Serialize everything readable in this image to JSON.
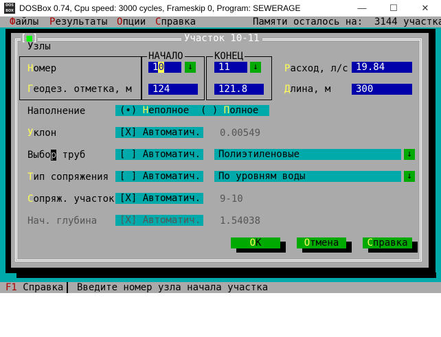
{
  "window": {
    "app_icon_text": "DOS BOX",
    "title": "DOSBox 0.74, Cpu speed:     3000 cycles, Frameskip  0, Program: SEWERAGE",
    "minimize": "—",
    "maximize": "☐",
    "close": "✕"
  },
  "menu": {
    "items": [
      {
        "hot": "Ф",
        "rest": "айлы"
      },
      {
        "hot": "Р",
        "rest": "езультаты"
      },
      {
        "hot": "О",
        "rest": "пции"
      },
      {
        "hot": "С",
        "rest": "правка"
      }
    ],
    "memory_text": "Памяти осталось на:  3144 участка"
  },
  "dialog": {
    "close_left": "[",
    "close_mark": "■",
    "close_right": "]",
    "title": "Участок 10-11",
    "nodes_label": "Узлы",
    "start_label": "НАЧАЛО",
    "end_label": "КОНЕЦ",
    "number": {
      "hot": "Н",
      "rest": "омер"
    },
    "elevation": {
      "hot": "Г",
      "rest": "еодез. отметка, м"
    },
    "start_number": {
      "a": "1",
      "b": "0"
    },
    "end_number": "11",
    "start_elevation": "124",
    "end_elevation": "121.8",
    "flow": {
      "hot": "Р",
      "rest": "асход, л/с"
    },
    "flow_value": "19.84",
    "length": {
      "hot": "Д",
      "rest": "лина, м"
    },
    "length_value": "300",
    "fill_label": "Наполнение",
    "fill_options": {
      "o1_mark": "(•)",
      "o1_hot": "Н",
      "o1_rest": "еполное",
      "o2_mark": "( )",
      "o2_hot": "П",
      "o2_rest": "олное"
    },
    "slope": {
      "hot": "У",
      "rest": "клон"
    },
    "slope_check": "[X] Автоматич.",
    "slope_value": "0.00549",
    "pipe": {
      "pre": "Выбо",
      "cursor": "р",
      "rest": " труб",
      "hot_index": "1"
    },
    "pipe_check": "[ ] Автоматич.",
    "pipe_value": "Полиэтиленовые",
    "conj": {
      "hot": "Т",
      "rest": "ип сопряжения"
    },
    "conj_check": "[ ] Автоматич.",
    "conj_value": "По уровням воды",
    "conj_section": {
      "hot": "С",
      "rest": "опряж. участок"
    },
    "conj_section_check": "[X] Автоматич.",
    "conj_section_value": "9-10",
    "depth_label": "Нач. глубина",
    "depth_check": "[X] Автоматич.",
    "depth_value": "1.54038",
    "ok": {
      "hot": "О",
      "rest": "К"
    },
    "cancel": {
      "hot": "О",
      "rest": "тмена"
    },
    "help": {
      "hot": "С",
      "rest": "правка"
    },
    "arrow": "↓"
  },
  "status": {
    "f1_key": "F1",
    "f1_label": "Справка",
    "hint": "Введите номер узла начала участка"
  },
  "colors": {
    "desktop": "#00aaaa",
    "panel": "#aaaaaa",
    "field": "#0000aa",
    "button": "#00aa00",
    "hotkey": "#ffff55",
    "menu_hotkey": "#aa0000"
  }
}
